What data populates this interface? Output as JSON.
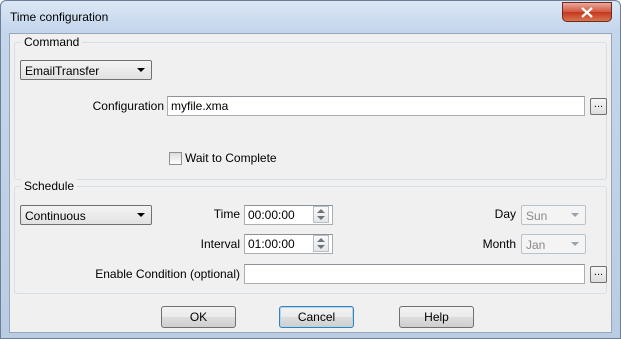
{
  "window": {
    "title": "Time configuration"
  },
  "command": {
    "group_label": "Command",
    "type_selected": "EmailTransfer",
    "configuration_label": "Configuration",
    "configuration_value": "myfile.xma",
    "browse_label": "...",
    "wait_label": "Wait to Complete",
    "wait_checked": false
  },
  "schedule": {
    "group_label": "Schedule",
    "mode_selected": "Continuous",
    "time_label": "Time",
    "time_value": "00:00:00",
    "interval_label": "Interval",
    "interval_value": "01:00:00",
    "day_label": "Day",
    "day_selected": "Sun",
    "month_label": "Month",
    "month_selected": "Jan",
    "enable_label": "Enable Condition (optional)",
    "enable_value": "",
    "browse_label": "..."
  },
  "buttons": {
    "ok": "OK",
    "cancel": "Cancel",
    "help": "Help"
  }
}
